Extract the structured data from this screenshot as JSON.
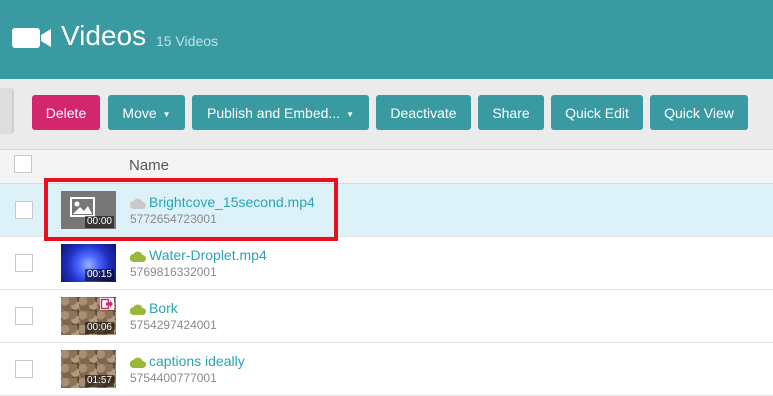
{
  "header": {
    "title": "Videos",
    "count": "15 Videos",
    "icon": "video-camera-icon"
  },
  "toolbar": {
    "delete": "Delete",
    "move": "Move",
    "publish": "Publish and Embed...",
    "deactivate": "Deactivate",
    "share": "Share",
    "quick_edit": "Quick Edit",
    "quick_view": "Quick View"
  },
  "table": {
    "name_header": "Name"
  },
  "rows": [
    {
      "name": "Brightcove_15second.mp4",
      "id": "5772654723001",
      "duration": "00:00",
      "status": "inactive",
      "selected": true
    },
    {
      "name": "Water-Droplet.mp4",
      "id": "5769816332001",
      "duration": "00:15",
      "status": "active"
    },
    {
      "name": "Bork",
      "id": "5754297424001",
      "duration": "00:06",
      "status": "active",
      "shared": true
    },
    {
      "name": "captions ideally",
      "id": "5754400777001",
      "duration": "01:57",
      "status": "active"
    }
  ],
  "colors": {
    "header_bg": "#3a9aa2",
    "delete_bg": "#d4266d",
    "button_bg": "#3a9aa2",
    "link": "#2aa4b3",
    "cloud_active": "#9ab83c",
    "cloud_inactive": "#c9c9c9",
    "highlight": "#e8101f"
  }
}
